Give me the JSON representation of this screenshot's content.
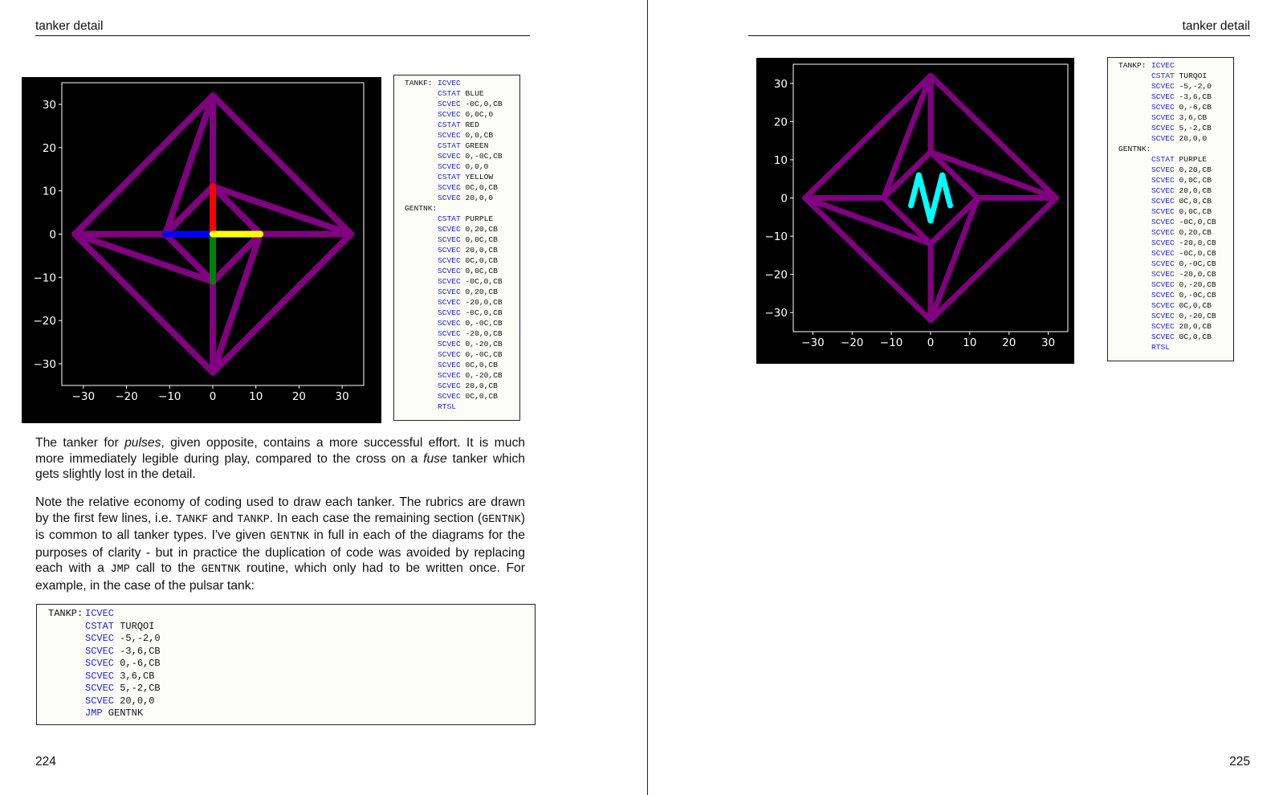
{
  "left": {
    "running_head": "tanker detail",
    "page_number": "224",
    "code_listing": [
      {
        "label": "TANKF:",
        "op": "ICVEC",
        "args": ""
      },
      {
        "label": "",
        "op": "CSTAT",
        "args": "BLUE"
      },
      {
        "label": "",
        "op": "SCVEC",
        "args": "-0C,0,CB"
      },
      {
        "label": "",
        "op": "SCVEC",
        "args": "0,0C,0"
      },
      {
        "label": "",
        "op": "CSTAT",
        "args": "RED"
      },
      {
        "label": "",
        "op": "SCVEC",
        "args": "0,0,CB"
      },
      {
        "label": "",
        "op": "CSTAT",
        "args": "GREEN"
      },
      {
        "label": "",
        "op": "SCVEC",
        "args": "0,-0C,CB"
      },
      {
        "label": "",
        "op": "SCVEC",
        "args": "0,0,0"
      },
      {
        "label": "",
        "op": "CSTAT",
        "args": "YELLOW"
      },
      {
        "label": "",
        "op": "SCVEC",
        "args": "0C,0,CB"
      },
      {
        "label": "",
        "op": "SCVEC",
        "args": "20,0,0"
      },
      {
        "label": "GENTNK:",
        "op": "",
        "args": ""
      },
      {
        "label": "",
        "op": "CSTAT",
        "args": "PURPLE"
      },
      {
        "label": "",
        "op": "SCVEC",
        "args": "0,20,CB"
      },
      {
        "label": "",
        "op": "SCVEC",
        "args": "0,0C,CB"
      },
      {
        "label": "",
        "op": "SCVEC",
        "args": "20,0,CB"
      },
      {
        "label": "",
        "op": "SCVEC",
        "args": "0C,0,CB"
      },
      {
        "label": "",
        "op": "SCVEC",
        "args": "0,0C,CB"
      },
      {
        "label": "",
        "op": "SCVEC",
        "args": "-0C,0,CB"
      },
      {
        "label": "",
        "op": "SCVEC",
        "args": "0,20,CB"
      },
      {
        "label": "",
        "op": "SCVEC",
        "args": "-20,0,CB"
      },
      {
        "label": "",
        "op": "SCVEC",
        "args": "-0C,0,CB"
      },
      {
        "label": "",
        "op": "SCVEC",
        "args": "0,-0C,CB"
      },
      {
        "label": "",
        "op": "SCVEC",
        "args": "-20,0,CB"
      },
      {
        "label": "",
        "op": "SCVEC",
        "args": "0,-20,CB"
      },
      {
        "label": "",
        "op": "SCVEC",
        "args": "0,-0C,CB"
      },
      {
        "label": "",
        "op": "SCVEC",
        "args": "0C,0,CB"
      },
      {
        "label": "",
        "op": "SCVEC",
        "args": "0,-20,CB"
      },
      {
        "label": "",
        "op": "SCVEC",
        "args": "20,0,CB"
      },
      {
        "label": "",
        "op": "SCVEC",
        "args": "0C,0,CB"
      },
      {
        "label": "",
        "op": "RTSL",
        "args": ""
      }
    ],
    "paragraphs": [
      [
        {
          "t": "The tanker for "
        },
        {
          "t": "pulses",
          "style": "italic"
        },
        {
          "t": ", given opposite, contains a more successful effort.  It is much more immediately legible during play, compared to the cross on a "
        },
        {
          "t": "fuse",
          "style": "italic"
        },
        {
          "t": " tanker which gets slightly lost in the detail."
        }
      ],
      [
        {
          "t": "Note the relative economy of coding used to draw each tanker.  The rubrics are drawn by the first few lines, i.e. "
        },
        {
          "t": "TANKF",
          "style": "mono"
        },
        {
          "t": " and "
        },
        {
          "t": "TANKP",
          "style": "mono"
        },
        {
          "t": ".  In each case the remaining section ("
        },
        {
          "t": "GENTNK",
          "style": "mono"
        },
        {
          "t": ") is common to all tanker types.  I've given "
        },
        {
          "t": "GENTNK",
          "style": "mono"
        },
        {
          "t": " in full in each of the diagrams for the purposes of clarity - but in practice the duplication of code was avoided by replacing each with a "
        },
        {
          "t": "JMP",
          "style": "mono"
        },
        {
          "t": " call to the "
        },
        {
          "t": "GENTNK",
          "style": "mono"
        },
        {
          "t": " routine, which only had to be written once.  For example, in the case of the pulsar tank:"
        }
      ]
    ],
    "bottom_listing": [
      {
        "label": "TANKP:",
        "op": "ICVEC",
        "args": ""
      },
      {
        "label": "",
        "op": "CSTAT",
        "args": "TURQOI"
      },
      {
        "label": "",
        "op": "SCVEC",
        "args": "-5,-2,0"
      },
      {
        "label": "",
        "op": "SCVEC",
        "args": "-3,6,CB"
      },
      {
        "label": "",
        "op": "SCVEC",
        "args": "0,-6,CB"
      },
      {
        "label": "",
        "op": "SCVEC",
        "args": "3,6,CB"
      },
      {
        "label": "",
        "op": "SCVEC",
        "args": "5,-2,CB"
      },
      {
        "label": "",
        "op": "SCVEC",
        "args": "20,0,0"
      },
      {
        "label": "",
        "op": "JMP",
        "args": "GENTNK"
      }
    ]
  },
  "right": {
    "running_head": "tanker detail",
    "page_number": "225",
    "code_listing": [
      {
        "label": "TANKP:",
        "op": "ICVEC",
        "args": ""
      },
      {
        "label": "",
        "op": "CSTAT",
        "args": "TURQOI"
      },
      {
        "label": "",
        "op": "SCVEC",
        "args": "-5,-2,0"
      },
      {
        "label": "",
        "op": "SCVEC",
        "args": "-3,6,CB"
      },
      {
        "label": "",
        "op": "SCVEC",
        "args": "0,-6,CB"
      },
      {
        "label": "",
        "op": "SCVEC",
        "args": "3,6,CB"
      },
      {
        "label": "",
        "op": "SCVEC",
        "args": "5,-2,CB"
      },
      {
        "label": "",
        "op": "SCVEC",
        "args": "20,0,0"
      },
      {
        "label": "GENTNK:",
        "op": "",
        "args": ""
      },
      {
        "label": "",
        "op": "CSTAT",
        "args": "PURPLE"
      },
      {
        "label": "",
        "op": "SCVEC",
        "args": "0,20,CB"
      },
      {
        "label": "",
        "op": "SCVEC",
        "args": "0,0C,CB"
      },
      {
        "label": "",
        "op": "SCVEC",
        "args": "20,0,CB"
      },
      {
        "label": "",
        "op": "SCVEC",
        "args": "0C,0,CB"
      },
      {
        "label": "",
        "op": "SCVEC",
        "args": "0,0C,CB"
      },
      {
        "label": "",
        "op": "SCVEC",
        "args": "-0C,0,CB"
      },
      {
        "label": "",
        "op": "SCVEC",
        "args": "0,20,CB"
      },
      {
        "label": "",
        "op": "SCVEC",
        "args": "-20,0,CB"
      },
      {
        "label": "",
        "op": "SCVEC",
        "args": "-0C,0,CB"
      },
      {
        "label": "",
        "op": "SCVEC",
        "args": "0,-0C,CB"
      },
      {
        "label": "",
        "op": "SCVEC",
        "args": "-20,0,CB"
      },
      {
        "label": "",
        "op": "SCVEC",
        "args": "0,-20,CB"
      },
      {
        "label": "",
        "op": "SCVEC",
        "args": "0,-0C,CB"
      },
      {
        "label": "",
        "op": "SCVEC",
        "args": "0C,0,CB"
      },
      {
        "label": "",
        "op": "SCVEC",
        "args": "0,-20,CB"
      },
      {
        "label": "",
        "op": "SCVEC",
        "args": "20,0,CB"
      },
      {
        "label": "",
        "op": "SCVEC",
        "args": "0C,0,CB"
      },
      {
        "label": "",
        "op": "RTSL",
        "args": ""
      }
    ]
  },
  "colors": {
    "keyword": "#2424d8",
    "purple": "#800080",
    "blue": "#0000ff",
    "red": "#ff0000",
    "green": "#007f00",
    "yellow": "#ffff00",
    "cyan": "#00ffff"
  },
  "diagrams": [
    {
      "name": "fuse-tanker",
      "xlim": [
        -35,
        35
      ],
      "ylim": [
        -35,
        35
      ],
      "ticks": [
        -30,
        -20,
        -10,
        0,
        10,
        20,
        30
      ],
      "tick_labels": [
        "−30",
        "−20",
        "−10",
        "0",
        "10",
        "20",
        "30"
      ],
      "outer": [
        [
          -32,
          0
        ],
        [
          0,
          32
        ],
        [
          32,
          0
        ],
        [
          0,
          -32
        ]
      ],
      "inner": [
        [
          -11,
          0
        ],
        [
          0,
          11
        ],
        [
          11,
          0
        ],
        [
          0,
          -11
        ]
      ],
      "rubric": [
        {
          "color": "blue",
          "points": [
            [
              -11,
              0
            ],
            [
              0,
              0
            ]
          ]
        },
        {
          "color": "red",
          "points": [
            [
              0,
              0
            ],
            [
              0,
              11
            ]
          ]
        },
        {
          "color": "green",
          "points": [
            [
              0,
              0
            ],
            [
              0,
              -11
            ]
          ]
        },
        {
          "color": "yellow",
          "points": [
            [
              0,
              0
            ],
            [
              11,
              0
            ]
          ]
        }
      ]
    },
    {
      "name": "pulsar-tanker",
      "xlim": [
        -35,
        35
      ],
      "ylim": [
        -35,
        35
      ],
      "ticks": [
        -30,
        -20,
        -10,
        0,
        10,
        20,
        30
      ],
      "tick_labels": [
        "−30",
        "−20",
        "−10",
        "0",
        "10",
        "20",
        "30"
      ],
      "outer": [
        [
          -32,
          0
        ],
        [
          0,
          32
        ],
        [
          32,
          0
        ],
        [
          0,
          -32
        ]
      ],
      "inner": [
        [
          -12,
          0
        ],
        [
          0,
          12
        ],
        [
          12,
          0
        ],
        [
          0,
          -12
        ]
      ],
      "rubric": [
        {
          "color": "cyan",
          "points": [
            [
              -5,
              -2
            ],
            [
              -3,
              6
            ],
            [
              0,
              -6
            ],
            [
              3,
              6
            ],
            [
              5,
              -2
            ]
          ]
        }
      ]
    }
  ]
}
